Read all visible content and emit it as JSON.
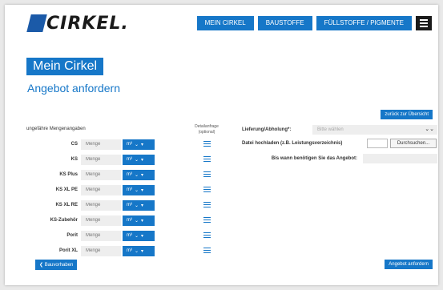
{
  "brand": {
    "logo_text": "CIRKEL."
  },
  "nav": {
    "items": [
      {
        "label": "MEIN CIRKEL"
      },
      {
        "label": "BAUSTOFFE"
      },
      {
        "label": "FÜLLSTOFFE / PIGMENTE"
      }
    ],
    "menu_icon": "hamburger-icon"
  },
  "page": {
    "title": "Mein Cirkel",
    "subtitle": "Angebot anfordern",
    "back_overview_label": "zurück zur Übersicht"
  },
  "quantities": {
    "heading": "ungefähre Mengenangaben",
    "detail_heading": "Detailanfrage",
    "detail_subheading": "(optional)",
    "placeholder": "Menge",
    "unit": "m³",
    "rows": [
      {
        "label": "CS"
      },
      {
        "label": "KS"
      },
      {
        "label": "KS Plus"
      },
      {
        "label": "KS XL PE"
      },
      {
        "label": "KS XL RE"
      },
      {
        "label": "KS-Zubehör"
      },
      {
        "label": "Porit"
      },
      {
        "label": "Porit XL"
      }
    ]
  },
  "delivery": {
    "label": "Lieferung/Abholung*:",
    "placeholder": "Bitte wählen",
    "file_label": "Datei hochladen (z.B. Leistungsverzeichnis)",
    "browse_label": "Durchsuchen...",
    "date_label": "Bis wann benötigen Sie das Angebot:"
  },
  "footer": {
    "back_label": "❮ Bauvorhaben",
    "submit_label": "Angebot anfordern"
  },
  "colors": {
    "accent": "#1677c8",
    "dark": "#1a1a1a"
  }
}
